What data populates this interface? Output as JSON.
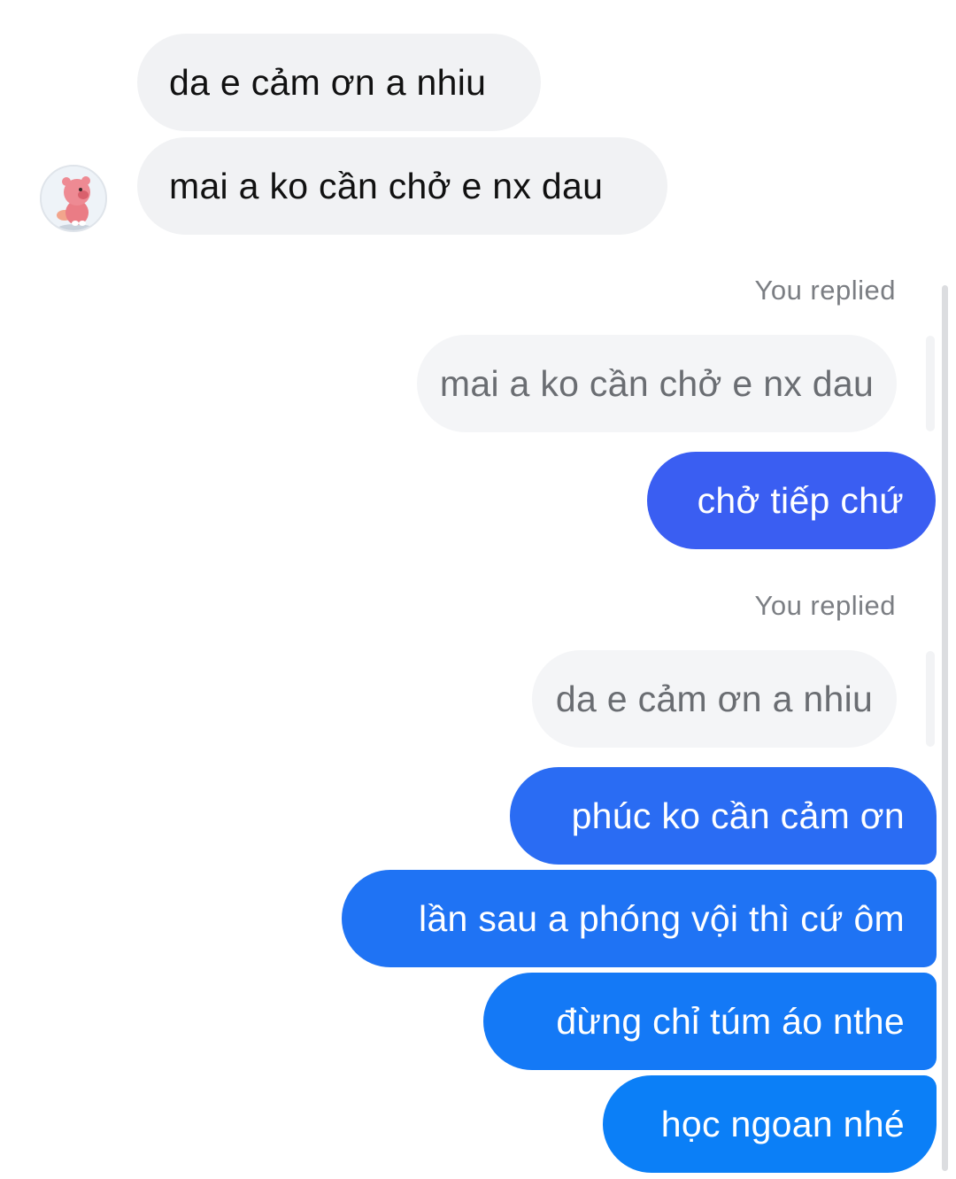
{
  "incoming_messages": [
    {
      "text": "da e cảm ơn a nhiu"
    },
    {
      "text": "mai a ko cần chở e nx dau"
    }
  ],
  "contact": {
    "avatar_icon": "pink-bear-avatar-icon"
  },
  "replies": [
    {
      "label": "You replied",
      "quoted_text": "mai a ko cần chở e nx dau",
      "messages": [
        "chở tiếp chứ"
      ]
    },
    {
      "label": "You replied",
      "quoted_text": "da e cảm ơn a nhiu",
      "messages": [
        "phúc ko cần cảm ơn",
        "lần sau a phóng vội thì cứ ôm",
        "đừng chỉ túm áo nthe",
        "học ngoan nhé"
      ]
    }
  ],
  "colors": {
    "outgoing_gradient_top": "#3a5cf2",
    "outgoing_gradient_mid": "#2a6df3",
    "outgoing_gradient_bottom": "#0b7ff7",
    "incoming_bubble": "#f1f2f4",
    "quote_bubble": "#f4f5f7",
    "meta_text": "#7b7e83"
  }
}
